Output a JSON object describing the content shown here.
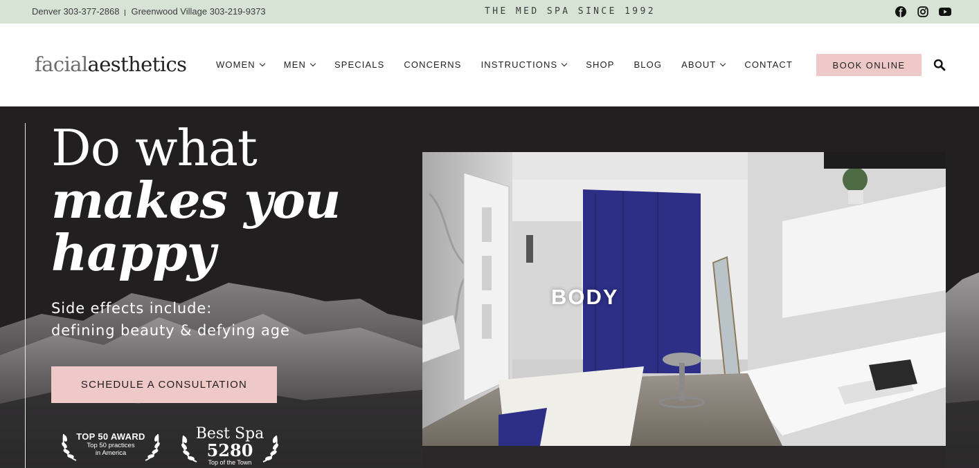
{
  "topbar": {
    "denver": "Denver 303-377-2868",
    "greenwood": "Greenwood Village 303-219-9373",
    "tagline": "THE MED SPA SINCE 1992",
    "social": [
      "facebook-icon",
      "instagram-icon",
      "youtube-icon"
    ]
  },
  "header": {
    "logo_light": "facial",
    "logo_dark": "aesthetics",
    "nav": [
      {
        "label": "WOMEN",
        "dropdown": true
      },
      {
        "label": "MEN",
        "dropdown": true
      },
      {
        "label": "SPECIALS",
        "dropdown": false
      },
      {
        "label": "CONCERNS",
        "dropdown": false
      },
      {
        "label": "INSTRUCTIONS",
        "dropdown": true
      },
      {
        "label": "SHOP",
        "dropdown": false
      },
      {
        "label": "BLOG",
        "dropdown": false
      },
      {
        "label": "ABOUT",
        "dropdown": true
      },
      {
        "label": "CONTACT",
        "dropdown": false
      }
    ],
    "book_label": "BOOK ONLINE"
  },
  "hero": {
    "headline_line1": "Do what",
    "headline_line2": "makes you",
    "headline_line3": "happy",
    "sub_line1": "Side effects include:",
    "sub_line2": "defining beauty & defying age",
    "cta_label": "SCHEDULE A CONSULTATION",
    "award1": {
      "title": "TOP 50 AWARD",
      "sub1": "Top 50 practices",
      "sub2": "in America"
    },
    "award2": {
      "title": "Best Spa",
      "number": "5280",
      "sub": "Top of the Town"
    },
    "video_caption": "BODY"
  },
  "colors": {
    "topbar_bg": "#d6e3d5",
    "accent_pink": "#efc9c8",
    "hero_bg": "#211f20"
  }
}
